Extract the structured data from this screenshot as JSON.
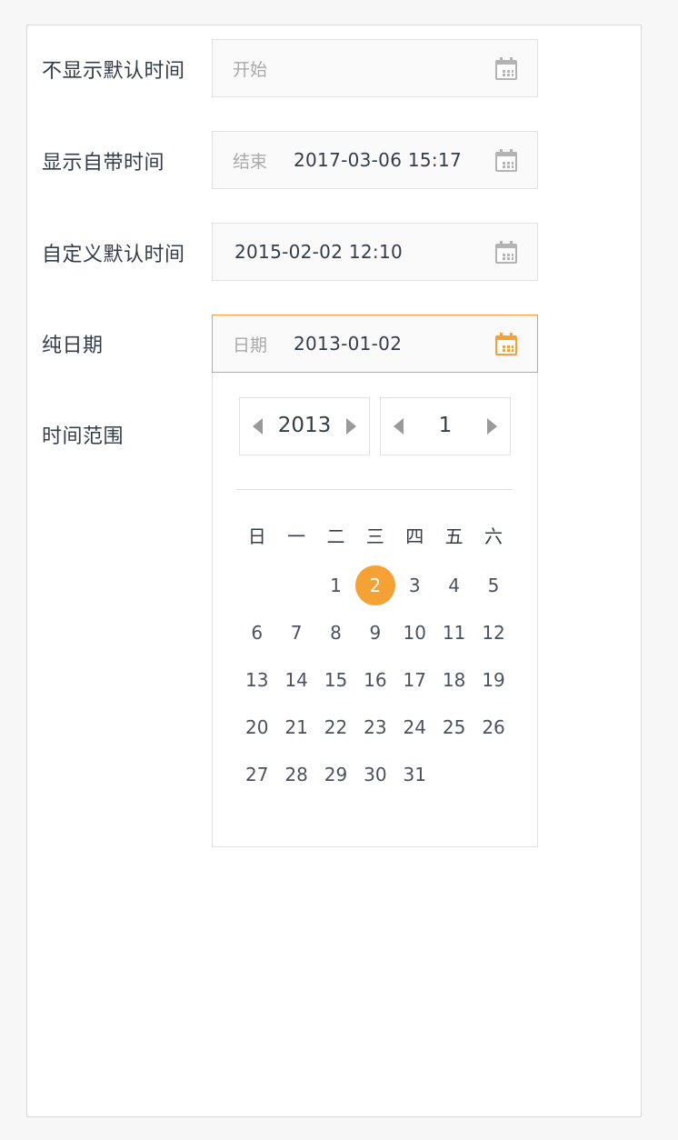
{
  "rows": [
    {
      "label": "不显示默认时间",
      "prefix": "开始",
      "value": ""
    },
    {
      "label": "显示自带时间",
      "prefix": "结束",
      "value": "2017-03-06 15:17"
    },
    {
      "label": "自定义默认时间",
      "prefix": "",
      "value": "2015-02-02 12:10"
    },
    {
      "label": "纯日期",
      "prefix": "日期",
      "value": "2013-01-02"
    },
    {
      "label": "时间范围"
    }
  ],
  "picker": {
    "year": "2013",
    "month": "1",
    "weekdays": [
      "日",
      "一",
      "二",
      "三",
      "四",
      "五",
      "六"
    ],
    "days": [
      "",
      "",
      "1",
      "2",
      "3",
      "4",
      "5",
      "6",
      "7",
      "8",
      "9",
      "10",
      "11",
      "12",
      "13",
      "14",
      "15",
      "16",
      "17",
      "18",
      "19",
      "20",
      "21",
      "22",
      "23",
      "24",
      "25",
      "26",
      "27",
      "28",
      "29",
      "30",
      "31"
    ],
    "selected_day": "2"
  },
  "colors": {
    "accent": "#f5a134",
    "text": "#333d4a",
    "placeholder": "#a9a9a9",
    "border": "#e2e2e2",
    "icon_inactive": "#b3b3b3"
  },
  "icons": {
    "field_icon": "calendar-icon",
    "prev": "triangle-left-icon",
    "next": "triangle-right-icon"
  }
}
